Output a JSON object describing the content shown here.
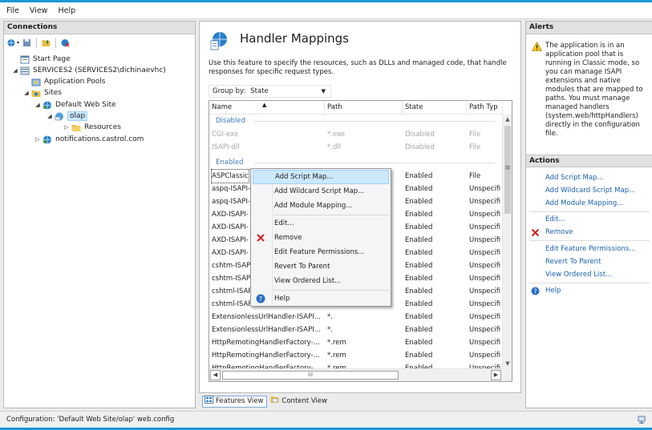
{
  "menu": [
    "File",
    "View",
    "Help"
  ],
  "connections": {
    "title": "Connections",
    "tree": [
      {
        "label": "Start Page"
      },
      {
        "label": "SERVICES2 (SERVICES2\\dichinaevhc)"
      },
      {
        "label": "Application Pools"
      },
      {
        "label": "Sites"
      },
      {
        "label": "Default Web Site"
      },
      {
        "label": "olap"
      },
      {
        "label": "Resources"
      },
      {
        "label": "notifications.castrol.com"
      }
    ]
  },
  "page": {
    "title": "Handler Mappings",
    "description": "Use this feature to specify the resources, such as DLLs and managed code, that handle responses for specific request types.",
    "groupby_label": "Group by:",
    "groupby_value": "State"
  },
  "grid": {
    "columns": [
      "Name",
      "Path",
      "State",
      "Path Typ"
    ],
    "groups": [
      "Disabled",
      "Enabled"
    ],
    "disabled_rows": [
      {
        "name": "CGI-exe",
        "path": "*.exe",
        "state": "Disabled",
        "type": "File"
      },
      {
        "name": "ISAPI-dll",
        "path": "*.dll",
        "state": "Disabled",
        "type": "File"
      }
    ],
    "enabled_rows": [
      {
        "name": "ASPClassic",
        "path": "",
        "state": "Enabled",
        "type": "File"
      },
      {
        "name": "aspq-ISAPI-",
        "path": "",
        "state": "Enabled",
        "type": "Unspecifi"
      },
      {
        "name": "aspq-ISAPI-",
        "path": "",
        "state": "Enabled",
        "type": "Unspecifi"
      },
      {
        "name": "AXD-ISAPI-",
        "path": "",
        "state": "Enabled",
        "type": "Unspecifi"
      },
      {
        "name": "AXD-ISAPI-",
        "path": "",
        "state": "Enabled",
        "type": "Unspecifi"
      },
      {
        "name": "AXD-ISAPI-",
        "path": "",
        "state": "Enabled",
        "type": "Unspecifi"
      },
      {
        "name": "AXD-ISAPI-",
        "path": "",
        "state": "Enabled",
        "type": "Unspecifi"
      },
      {
        "name": "cshtm-ISAP",
        "path": "",
        "state": "Enabled",
        "type": "Unspecifi"
      },
      {
        "name": "cshtm-ISAP",
        "path": "",
        "state": "Enabled",
        "type": "Unspecifi"
      },
      {
        "name": "cshtml-ISAP",
        "path": "",
        "state": "Enabled",
        "type": "Unspecifi"
      },
      {
        "name": "cshtml-ISAP",
        "path": "",
        "state": "Enabled",
        "type": "Unspecifi"
      },
      {
        "name": "ExtensionlessUrlHandler-ISAPI...",
        "path": "*.",
        "state": "Enabled",
        "type": "Unspecifi"
      },
      {
        "name": "ExtensionlessUrlHandler-ISAPI...",
        "path": "*.",
        "state": "Enabled",
        "type": "Unspecifi"
      },
      {
        "name": "HttpRemotingHandlerFactory-...",
        "path": "*.rem",
        "state": "Enabled",
        "type": "Unspecifi"
      },
      {
        "name": "HttpRemotingHandlerFactory-...",
        "path": "*.rem",
        "state": "Enabled",
        "type": "Unspecifi"
      },
      {
        "name": "HttpRemotingHandlerFactory-...",
        "path": "*.rem",
        "state": "Enabled",
        "type": "Unspecifi"
      }
    ],
    "hscroll_glyph": "III"
  },
  "context_menu": [
    "Add Script Map...",
    "Add Wildcard Script Map...",
    "Add Module Mapping...",
    "Edit...",
    "Remove",
    "Edit Feature Permissions...",
    "Revert To Parent",
    "View Ordered List...",
    "Help"
  ],
  "view_tabs": [
    "Features View",
    "Content View"
  ],
  "alerts": {
    "title": "Alerts",
    "message": "The application is in an application pool that is running in Classic mode, so you can manage ISAPI extensions and native modules that are mapped to paths. You must manage managed handlers (system.web/httpHandlers) directly in the configuration file."
  },
  "actions": {
    "title": "Actions",
    "items": [
      "Add Script Map...",
      "Add Wildcard Script Map...",
      "Add Module Mapping...",
      "Edit...",
      "Remove",
      "Edit Feature Permissions...",
      "Revert To Parent",
      "View Ordered List...",
      "Help"
    ]
  },
  "status": {
    "text": "Configuration: 'Default Web Site/olap' web.config"
  },
  "colors": {
    "accent": "#1c97d5",
    "link": "#1a5fad",
    "group": "#3f79b7",
    "highlight": "#cce8ff"
  }
}
